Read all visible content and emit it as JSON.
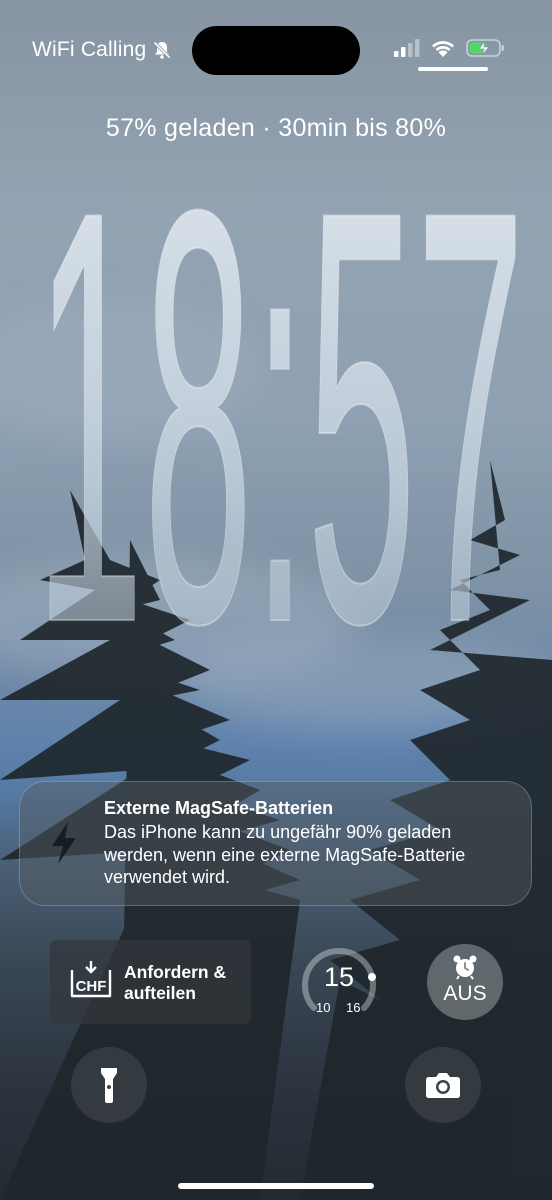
{
  "status_bar": {
    "carrier": "WiFi Calling",
    "mute_icon": "bell-slash-icon",
    "signal_icon": "cellular-signal-icon",
    "wifi_icon": "wifi-icon",
    "battery_icon": "battery-charging-icon"
  },
  "lock_screen": {
    "charge_status": "57% geladen · 30min bis 80%",
    "time": "18:57"
  },
  "notification": {
    "icon": "lightning-bolt-icon",
    "title": "Externe MagSafe-Batterien",
    "body": "Das iPhone kann zu ungefähr 90% geladen werden, wenn eine externe MagSafe-Batterie verwendet wird."
  },
  "widgets": {
    "payment": {
      "icon": "chf-request-icon",
      "icon_text": "CHF",
      "label_line1": "Anfordern &",
      "label_line2": "aufteilen"
    },
    "weather_gauge": {
      "value": "15",
      "min": "10",
      "max": "16"
    },
    "alarm": {
      "icon": "alarm-clock-icon",
      "label": "AUS"
    }
  },
  "quick_actions": {
    "flashlight_icon": "flashlight-icon",
    "camera_icon": "camera-icon"
  },
  "colors": {
    "accent_battery": "#4cd964",
    "text": "#ffffff"
  }
}
